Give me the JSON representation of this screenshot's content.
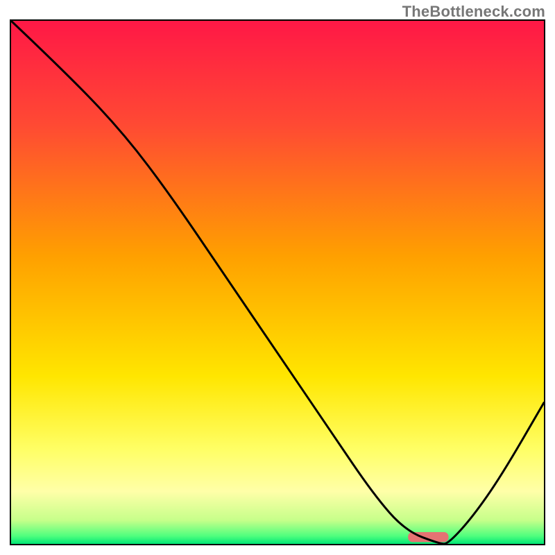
{
  "watermark": "TheBottleneck.com",
  "chart_data": {
    "type": "line",
    "title": "",
    "xlabel": "",
    "ylabel": "",
    "xlim": [
      0,
      100
    ],
    "ylim": [
      0,
      100
    ],
    "grid": false,
    "legend": false,
    "gradient_stops": [
      {
        "offset": 0,
        "color": "#ff1846"
      },
      {
        "offset": 0.2,
        "color": "#ff4a33"
      },
      {
        "offset": 0.45,
        "color": "#ffa000"
      },
      {
        "offset": 0.68,
        "color": "#ffe600"
      },
      {
        "offset": 0.82,
        "color": "#ffff66"
      },
      {
        "offset": 0.9,
        "color": "#ffffa8"
      },
      {
        "offset": 0.955,
        "color": "#c6ff8a"
      },
      {
        "offset": 0.985,
        "color": "#4fff7e"
      },
      {
        "offset": 1.0,
        "color": "#00e676"
      }
    ],
    "series": [
      {
        "name": "curve",
        "x": [
          0.0,
          11.4,
          21.5,
          30.0,
          40.0,
          50.0,
          60.0,
          68.0,
          74.0,
          80.5,
          82.0,
          86.5,
          92.0,
          100.0
        ],
        "y": [
          100.0,
          89.0,
          78.0,
          66.5,
          51.5,
          36.5,
          21.5,
          9.5,
          2.5,
          0.0,
          0.0,
          5.0,
          13.0,
          27.0
        ]
      }
    ],
    "marker": {
      "x_center": 78.3,
      "y_center": 1.3,
      "width": 7.6,
      "height": 1.9,
      "rx_frac": 0.45,
      "color": "#e57373"
    }
  }
}
